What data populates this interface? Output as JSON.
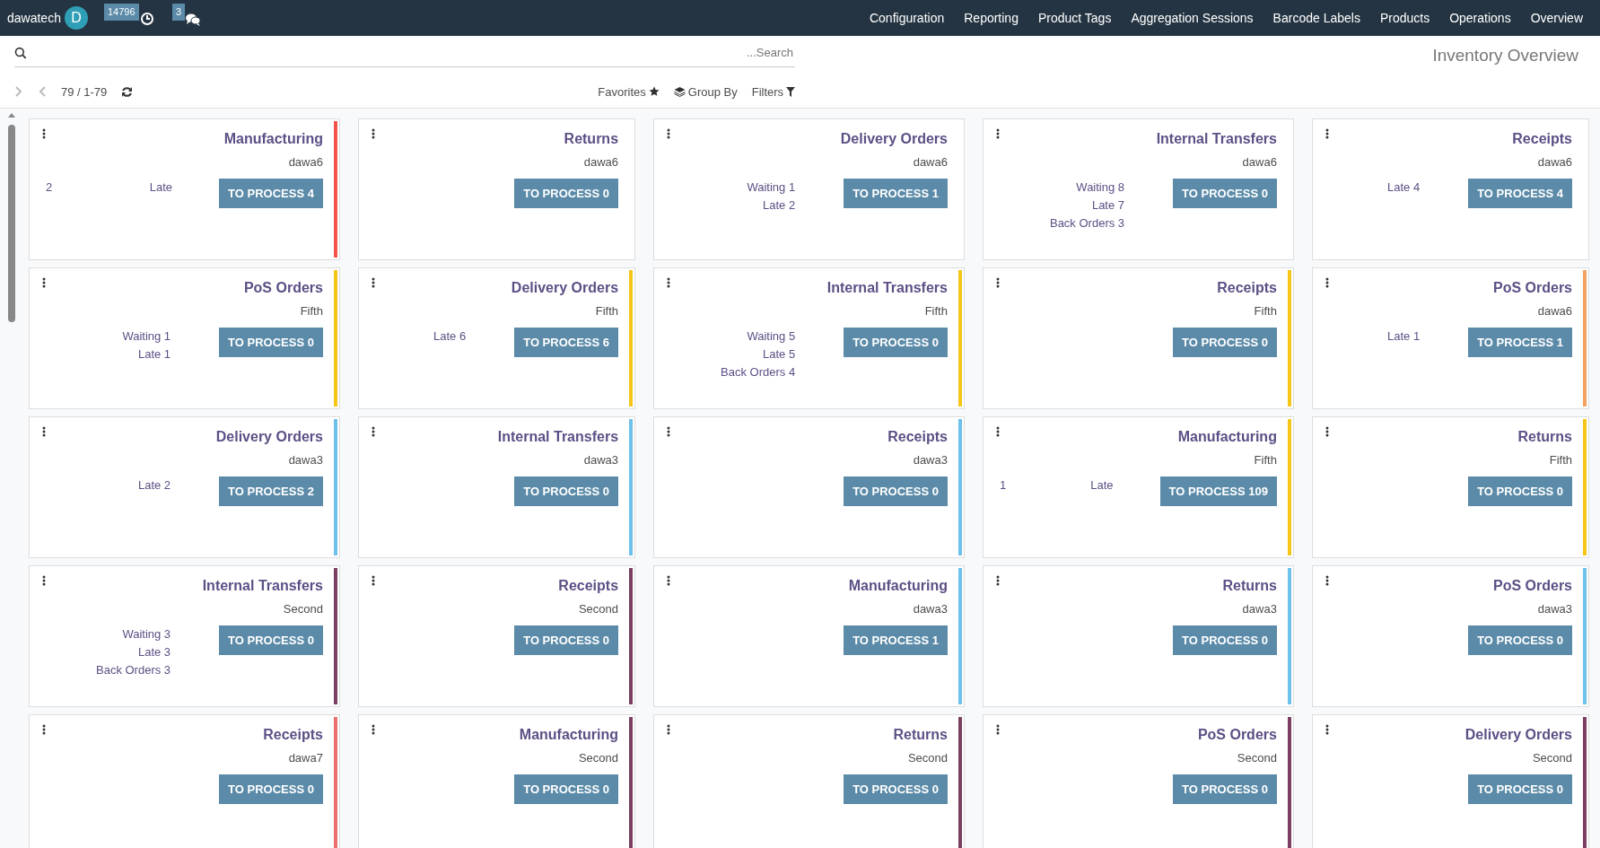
{
  "navbar": {
    "company": "dawatech",
    "avatar": "D",
    "activity_count": "14796",
    "message_count": "3",
    "menu": [
      "Configuration",
      "Reporting",
      "Product Tags",
      "Aggregation Sessions",
      "Barcode Labels",
      "Products",
      "Operations",
      "Overview"
    ]
  },
  "search": {
    "placeholder": "...Search"
  },
  "title": "Inventory Overview",
  "pager": "79 / 1-79",
  "filters": [
    {
      "label": "Favorites",
      "kind": "favorites"
    },
    {
      "label": "Group By",
      "kind": "group_by"
    },
    {
      "label": "Filters",
      "kind": "filters"
    }
  ],
  "cards": [
    {
      "title": "Manufacturing",
      "company": "dawa6",
      "count": "2",
      "lines": [
        "Late"
      ],
      "button": "TO PROCESS 4",
      "color": "#f0544a"
    },
    {
      "title": "Returns",
      "company": "dawa6",
      "button": "TO PROCESS 0"
    },
    {
      "title": "Delivery Orders",
      "company": "dawa6",
      "lines": [
        "Waiting 1",
        "Late 2"
      ],
      "button": "TO PROCESS 1"
    },
    {
      "title": "Internal Transfers",
      "company": "dawa6",
      "lines": [
        "Waiting 8",
        "Late 7",
        "Back Orders 3"
      ],
      "button": "TO PROCESS 0"
    },
    {
      "title": "Receipts",
      "company": "dawa6",
      "lines": [
        "Late 4"
      ],
      "button": "TO PROCESS 4"
    },
    {
      "title": "PoS Orders",
      "company": "Fifth",
      "lines": [
        "Waiting 1",
        "Late 1"
      ],
      "button": "TO PROCESS 0",
      "color": "#f5c518"
    },
    {
      "title": "Delivery Orders",
      "company": "Fifth",
      "lines": [
        "Late 6"
      ],
      "button": "TO PROCESS 6",
      "color": "#f5c518"
    },
    {
      "title": "Internal Transfers",
      "company": "Fifth",
      "lines": [
        "Waiting 5",
        "Late 5",
        "Back Orders 4"
      ],
      "button": "TO PROCESS 0",
      "color": "#f5c518"
    },
    {
      "title": "Receipts",
      "company": "Fifth",
      "button": "TO PROCESS 0",
      "color": "#f5c518"
    },
    {
      "title": "PoS Orders",
      "company": "dawa6",
      "lines": [
        "Late 1"
      ],
      "button": "TO PROCESS 1",
      "color": "#f4a261"
    },
    {
      "title": "Delivery Orders",
      "company": "dawa3",
      "lines": [
        "Late 2"
      ],
      "button": "TO PROCESS 2",
      "color": "#6ec1ea"
    },
    {
      "title": "Internal Transfers",
      "company": "dawa3",
      "button": "TO PROCESS 0",
      "color": "#6ec1ea"
    },
    {
      "title": "Receipts",
      "company": "dawa3",
      "button": "TO PROCESS 0",
      "color": "#6ec1ea"
    },
    {
      "title": "Manufacturing",
      "company": "Fifth",
      "count": "1",
      "lines": [
        "Late"
      ],
      "button": "TO PROCESS 109",
      "color": "#f5c518"
    },
    {
      "title": "Returns",
      "company": "Fifth",
      "button": "TO PROCESS 0",
      "color": "#f5c518"
    },
    {
      "title": "Internal Transfers",
      "company": "Second",
      "lines": [
        "Waiting 3",
        "Late 3",
        "Back Orders 3"
      ],
      "button": "TO PROCESS 0",
      "color": "#7b3f61"
    },
    {
      "title": "Receipts",
      "company": "Second",
      "button": "TO PROCESS 0",
      "color": "#7b3f61"
    },
    {
      "title": "Manufacturing",
      "company": "dawa3",
      "button": "TO PROCESS 1",
      "color": "#6ec1ea"
    },
    {
      "title": "Returns",
      "company": "dawa3",
      "button": "TO PROCESS 0",
      "color": "#6ec1ea"
    },
    {
      "title": "PoS Orders",
      "company": "dawa3",
      "button": "TO PROCESS 0",
      "color": "#6ec1ea"
    },
    {
      "title": "Receipts",
      "company": "dawa7",
      "button": "TO PROCESS 0",
      "color": "#e9706c"
    },
    {
      "title": "Manufacturing",
      "company": "Second",
      "button": "TO PROCESS 0",
      "color": "#7b3f61"
    },
    {
      "title": "Returns",
      "company": "Second",
      "button": "TO PROCESS 0",
      "color": "#7b3f61"
    },
    {
      "title": "PoS Orders",
      "company": "Second",
      "button": "TO PROCESS 0",
      "color": "#7b3f61"
    },
    {
      "title": "Delivery Orders",
      "company": "Second",
      "button": "TO PROCESS 0",
      "color": "#7b3f61"
    }
  ]
}
